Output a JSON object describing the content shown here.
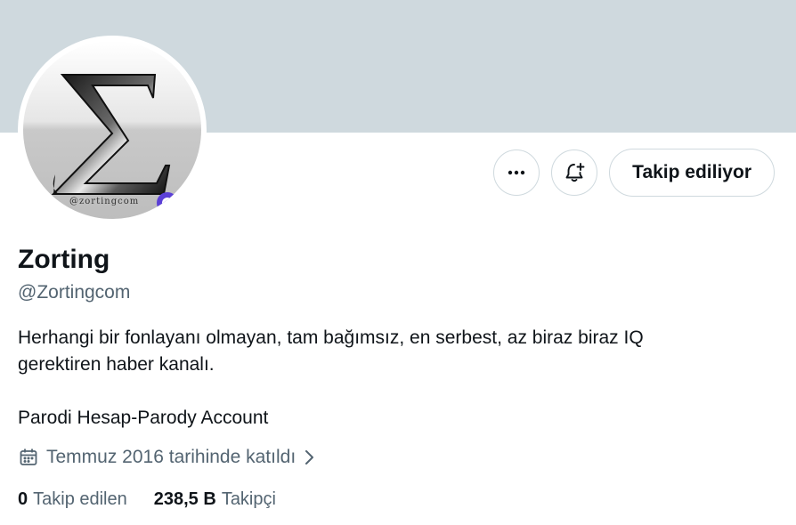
{
  "profile": {
    "display_name": "Zorting",
    "handle": "@Zortingcom",
    "bio_lines": [
      "Herhangi bir fonlayanı olmayan, tam bağımsız, en serbest, az biraz biraz IQ",
      "gerektiren haber kanalı."
    ],
    "bio_extra": "Parodi Hesap-Parody Account",
    "joined": "Temmuz 2016 tarihinde katıldı",
    "avatar_watermark": "@zortingcom",
    "avatar_letter": "Σ"
  },
  "actions": {
    "more_icon": "more-horizontal-icon",
    "notify_icon": "bell-plus-icon",
    "follow_label": "Takip ediliyor"
  },
  "stats": {
    "following_count": "0",
    "following_label": "Takip edilen",
    "followers_count": "238,5 B",
    "followers_label": "Takipçi"
  },
  "colors": {
    "banner": "#cfd9de",
    "text_primary": "#0f1419",
    "text_secondary": "#536471",
    "border": "#cfd9de"
  }
}
